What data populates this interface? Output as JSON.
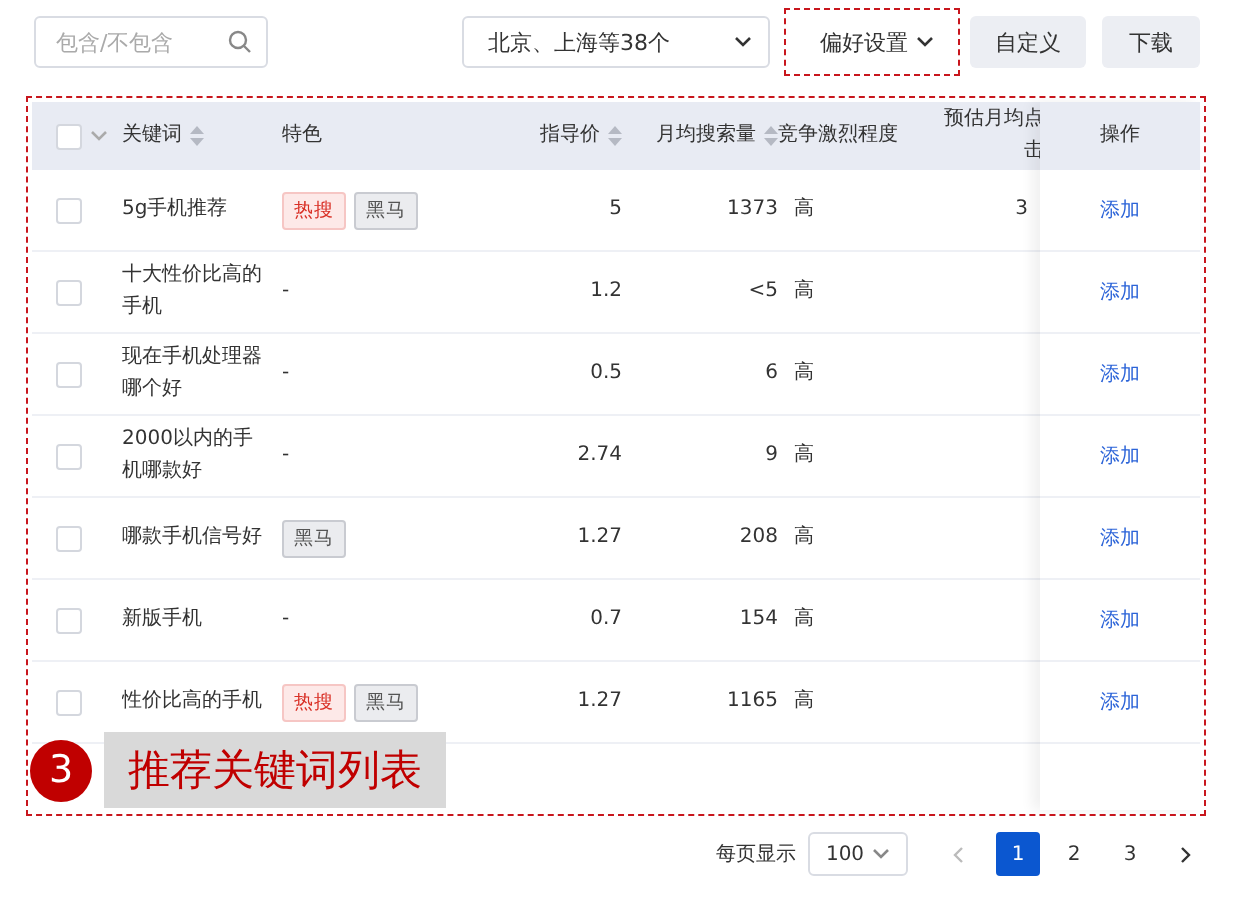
{
  "toolbar": {
    "search": {
      "placeholder": "包含/不包含"
    },
    "region": "北京、上海等38个",
    "preference": "偏好设置",
    "buttons": [
      "自定义",
      "下载"
    ]
  },
  "table": {
    "select_all_checked": false,
    "columns": [
      {
        "label": "关键词",
        "sortable": true
      },
      {
        "label": "特色",
        "sortable": false
      },
      {
        "label": "指导价",
        "sortable": true
      },
      {
        "label": "月均搜索量",
        "sortable": true
      },
      {
        "label": "竞争激烈程度",
        "sortable": false
      },
      {
        "label": "预估月均点",
        "label_line_2": "击",
        "sortable": false
      },
      {
        "label": "操作",
        "sortable": false
      }
    ],
    "rows": [
      {
        "checked": false,
        "keyword": "5g手机推荐",
        "tags": [
          {
            "label": "热搜",
            "kind": "hot"
          },
          {
            "label": "黑马",
            "kind": "dark"
          }
        ],
        "price": "5",
        "searches": "1373",
        "competition": "高",
        "clicks": "3",
        "action": "添加"
      },
      {
        "checked": false,
        "keyword": "十大性价比高的手机",
        "tags": [],
        "feature": "-",
        "price": "1.2",
        "searches": "<5",
        "competition": "高",
        "action": "添加"
      },
      {
        "checked": false,
        "keyword": "现在手机处理器哪个好",
        "tags": [],
        "feature": "-",
        "price": "0.5",
        "searches": "6",
        "competition": "高",
        "action": "添加"
      },
      {
        "checked": false,
        "keyword": "2000以内的手机哪款好",
        "tags": [],
        "feature": "-",
        "price": "2.74",
        "searches": "9",
        "competition": "高",
        "action": "添加"
      },
      {
        "checked": false,
        "keyword": "哪款手机信号好",
        "tags": [
          {
            "label": "黑马",
            "kind": "dark"
          }
        ],
        "price": "1.27",
        "searches": "208",
        "competition": "高",
        "action": "添加"
      },
      {
        "checked": false,
        "keyword": "新版手机",
        "tags": [],
        "feature": "-",
        "price": "0.7",
        "searches": "154",
        "competition": "高",
        "action": "添加"
      },
      {
        "checked": false,
        "keyword": "性价比高的手机",
        "tags": [
          {
            "label": "热搜",
            "kind": "hot"
          },
          {
            "label": "黑马",
            "kind": "dark"
          }
        ],
        "price": "1.27",
        "searches": "1165",
        "competition": "高",
        "action": "添加"
      }
    ]
  },
  "annotation": {
    "number": "3",
    "label": "推荐关键词列表"
  },
  "pagination": {
    "per_page_label": "每页显示",
    "per_page": "100",
    "pages": [
      {
        "label": "1",
        "selected": true
      },
      {
        "label": "2",
        "selected": false
      },
      {
        "label": "3",
        "selected": false
      }
    ]
  }
}
